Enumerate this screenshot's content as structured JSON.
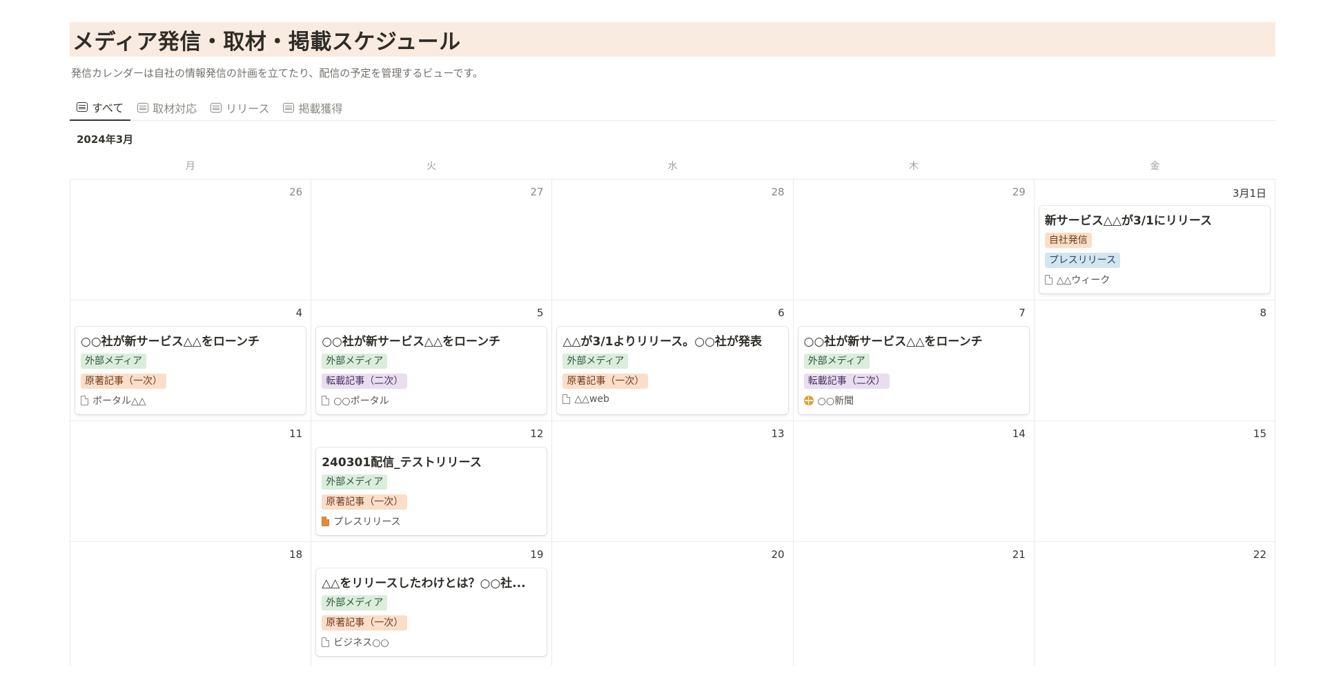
{
  "page": {
    "title": "メディア発信・取材・掲載スケジュール",
    "description": "発信カレンダーは自社の情報発信の計画を立てたり、配信の予定を管理するビューです。"
  },
  "tabs": [
    {
      "label": "すべて",
      "icon": "table-icon",
      "active": true
    },
    {
      "label": "取材対応",
      "icon": "table-icon",
      "active": false
    },
    {
      "label": "リリース",
      "icon": "table-icon",
      "active": false
    },
    {
      "label": "掲載獲得",
      "icon": "table-icon",
      "active": false
    }
  ],
  "calendar": {
    "month_label": "2024年3月",
    "weekdays": [
      "月",
      "火",
      "水",
      "木",
      "金"
    ],
    "weeks": [
      {
        "days": [
          "26",
          "27",
          "28",
          "29",
          "3月1日"
        ]
      },
      {
        "days": [
          "4",
          "5",
          "6",
          "7",
          "8"
        ]
      },
      {
        "days": [
          "11",
          "12",
          "13",
          "14",
          "15"
        ]
      },
      {
        "days": [
          "18",
          "19",
          "20",
          "21",
          "22"
        ]
      }
    ]
  },
  "events": {
    "mar1": {
      "title": "新サービス△△が3/1にリリース",
      "tag1": "自社発信",
      "tag2": "プレスリリース",
      "media": "△△ウィーク",
      "media_icon": "document-icon"
    },
    "mar4": {
      "title": "○○社が新サービス△△をローンチ",
      "tag1": "外部メディア",
      "tag2": "原著記事（一次）",
      "media": "ポータル△△",
      "media_icon": "document-icon"
    },
    "mar5": {
      "title": "○○社が新サービス△△をローンチ",
      "tag1": "外部メディア",
      "tag2": "転載記事（二次）",
      "media": "○○ポータル",
      "media_icon": "document-icon"
    },
    "mar6": {
      "title": "△△が3/1よりリリース。○○社が発表",
      "tag1": "外部メディア",
      "tag2": "原著記事（一次）",
      "media": "△△web",
      "media_icon": "document-icon"
    },
    "mar7": {
      "title": "○○社が新サービス△△をローンチ",
      "tag1": "外部メディア",
      "tag2": "転載記事（二次）",
      "media": "○○新聞",
      "media_icon": "globe-icon"
    },
    "mar12": {
      "title": "240301配信_テストリリース",
      "tag1": "外部メディア",
      "tag2": "原著記事（一次）",
      "media": "プレスリリース",
      "media_icon": "document-filled-icon"
    },
    "mar19": {
      "title": "△△をリリースしたわけとは？○○社...",
      "tag1": "外部メディア",
      "tag2": "原著記事（一次）",
      "media": "ビジネス○○",
      "media_icon": "document-icon"
    }
  },
  "colors": {
    "title_bg": "#f9ebe0",
    "tag_green": "#dbeddb",
    "tag_orange": "#fadec9",
    "tag_purple": "#e8deee",
    "tag_blue": "#d3e5ef"
  }
}
